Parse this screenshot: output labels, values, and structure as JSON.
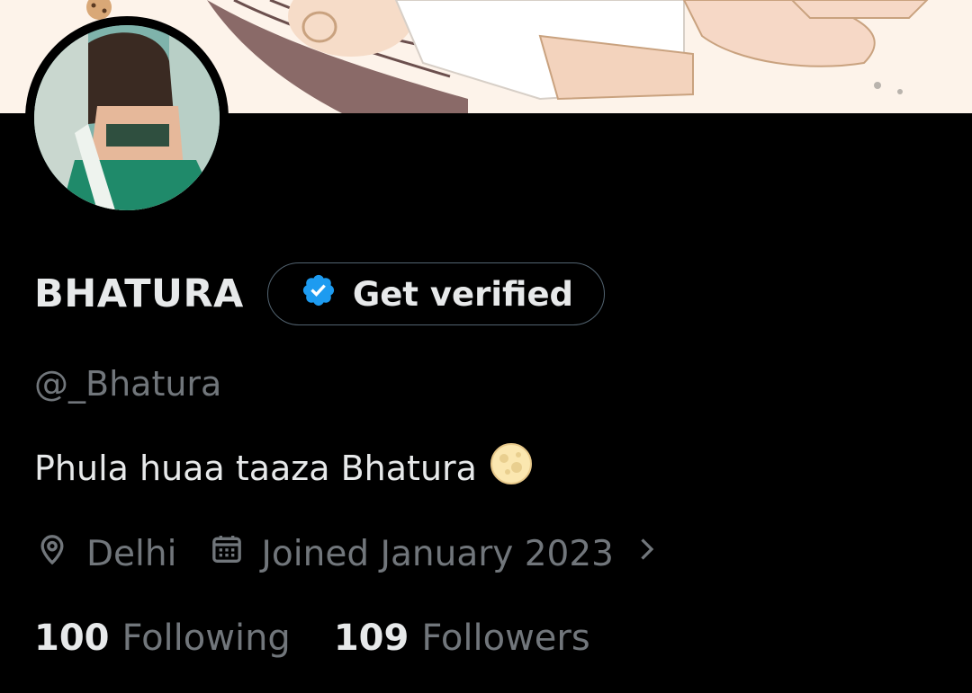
{
  "profile": {
    "display_name": "BHATURA",
    "verify_label": "Get verified",
    "handle": "@_Bhatura",
    "bio": "Phula huaa taaza Bhatura",
    "bio_emoji": "full-moon-icon",
    "location": "Delhi",
    "joined": "Joined January 2023",
    "following_count": "100",
    "following_label": "Following",
    "followers_count": "109",
    "followers_label": "Followers"
  },
  "colors": {
    "background": "#000000",
    "text_primary": "#e7e9ea",
    "text_secondary": "#71767b",
    "verified_blue": "#1d9bf0",
    "banner": "#fdf3ea"
  },
  "icons": [
    "verified-badge-icon",
    "location-pin-icon",
    "calendar-icon",
    "chevron-right-icon",
    "full-moon-icon"
  ]
}
